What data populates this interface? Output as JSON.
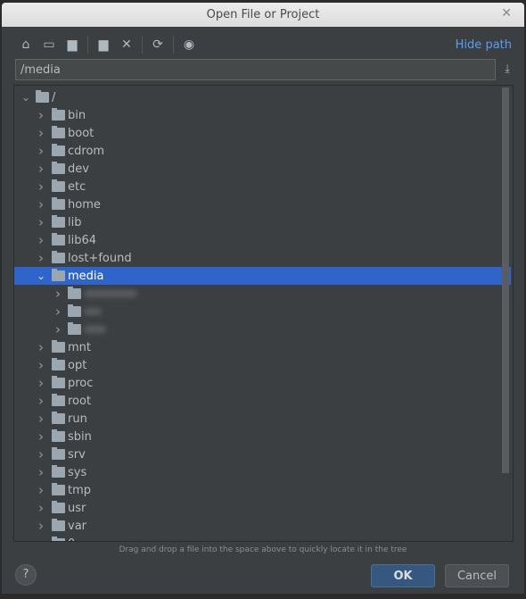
{
  "window": {
    "title": "Open File or Project"
  },
  "toolbar": {
    "icons": [
      "home-icon",
      "desktop-icon",
      "project-folder-icon",
      "new-folder-icon",
      "delete-icon",
      "refresh-icon",
      "show-hidden-icon"
    ],
    "hide_path": "Hide path"
  },
  "path": {
    "value": "/media"
  },
  "tree": {
    "root": "/",
    "items_before": [
      "bin",
      "boot",
      "cdrom",
      "dev",
      "etc",
      "home",
      "lib",
      "lib64",
      "lost+found"
    ],
    "selected": "media",
    "items_after": [
      "mnt",
      "opt",
      "proc",
      "root",
      "run",
      "sbin",
      "srv",
      "sys",
      "tmp",
      "usr",
      "var"
    ],
    "last": "0"
  },
  "hint": "Drag and drop a file into the space above to quickly locate it in the tree",
  "buttons": {
    "help": "?",
    "ok": "OK",
    "cancel": "Cancel"
  },
  "colors": {
    "selection": "#2f65ca",
    "link": "#589df6",
    "ok": "#365880"
  }
}
